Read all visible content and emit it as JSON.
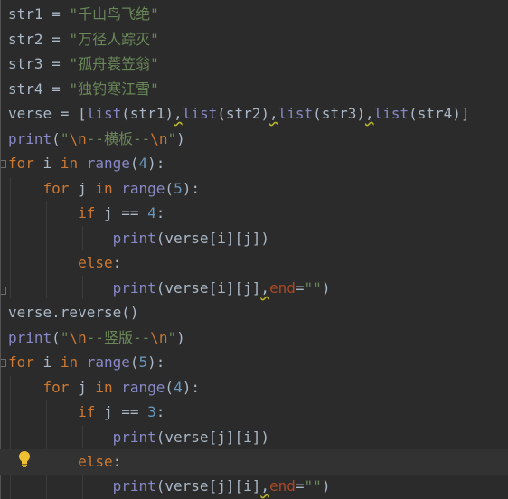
{
  "editor": {
    "lines": [
      "str1 = \"千山鸟飞绝\"",
      "str2 = \"万径人踪灭\"",
      "str3 = \"孤舟蓑笠翁\"",
      "str4 = \"独钓寒江雪\"",
      "verse = [list(str1),list(str2),list(str3),list(str4)]",
      "print(\"\\n--横板--\\n\")",
      "for i in range(4):",
      "    for j in range(5):",
      "        if j == 4:",
      "            print(verse[i][j])",
      "        else:",
      "            print(verse[i][j],end=\"\")",
      "verse.reverse()",
      "print(\"\\n--竖版--\\n\")",
      "for i in range(5):",
      "    for j in range(4):",
      "        if j == 3:",
      "            print(verse[j][i])",
      "        else:",
      "            print(verse[j][i],end=\"\")"
    ]
  },
  "tokens": {
    "l0": {
      "name": "str1",
      "op": " = ",
      "s1": "\"",
      "s2": "千山鸟飞绝",
      "s3": "\""
    },
    "l1": {
      "name": "str2",
      "op": " = ",
      "s1": "\"",
      "s2": "万径人踪灭",
      "s3": "\""
    },
    "l2": {
      "name": "str3",
      "op": " = ",
      "s1": "\"",
      "s2": "孤舟蓑笠翁",
      "s3": "\""
    },
    "l3": {
      "name": "str4",
      "op": " = ",
      "s1": "\"",
      "s2": "独钓寒江雪",
      "s3": "\""
    },
    "l4": {
      "a": "verse = [",
      "f1": "list",
      "p1": "(str1)",
      "c1": ",",
      "f2": "list",
      "p2": "(str2)",
      "c2": ",",
      "f3": "list",
      "p3": "(str3)",
      "c3": ",",
      "f4": "list",
      "p4": "(str4)]"
    },
    "l5": {
      "f": "print",
      "o": "(",
      "q1": "\"",
      "e1": "\\n",
      "t": "--横板--",
      "e2": "\\n",
      "q2": "\"",
      "c": ")"
    },
    "l6": {
      "k1": "for",
      "v": " i ",
      "k2": "in",
      "sp": " ",
      "f": "range",
      "o": "(",
      "n": "4",
      "c": "):"
    },
    "l7": {
      "ind": "    ",
      "k1": "for",
      "v": " j ",
      "k2": "in",
      "sp": " ",
      "f": "range",
      "o": "(",
      "n": "5",
      "c": "):"
    },
    "l8": {
      "ind": "        ",
      "k": "if",
      "e": " j == ",
      "n": "4",
      "c": ":"
    },
    "l9": {
      "ind": "            ",
      "f": "print",
      "r": "(verse[i][j])"
    },
    "l10": {
      "ind": "        ",
      "k": "else",
      "c": ":"
    },
    "l11": {
      "ind": "            ",
      "f": "print",
      "r": "(verse[i][j]",
      "cm": ",",
      "p": "end",
      "eq": "=",
      "s": "\"\"",
      "c": ")"
    },
    "l12": {
      "t": "verse.reverse()"
    },
    "l13": {
      "f": "print",
      "o": "(",
      "q1": "\"",
      "e1": "\\n",
      "t": "--竖版--",
      "e2": "\\n",
      "q2": "\"",
      "c": ")"
    },
    "l14": {
      "k1": "for",
      "v": " i ",
      "k2": "in",
      "sp": " ",
      "f": "range",
      "o": "(",
      "n": "5",
      "c": "):"
    },
    "l15": {
      "ind": "    ",
      "k1": "for",
      "v": " j ",
      "k2": "in",
      "sp": " ",
      "f": "range",
      "o": "(",
      "n": "4",
      "c": "):"
    },
    "l16": {
      "ind": "        ",
      "k": "if",
      "e": " j == ",
      "n": "3",
      "c": ":"
    },
    "l17": {
      "ind": "            ",
      "f": "print",
      "r": "(verse[j][i])"
    },
    "l18": {
      "ind": "        ",
      "k": "else",
      "c": ":"
    },
    "l19": {
      "ind": "            ",
      "f": "print",
      "r": "(verse[j][i]",
      "cm": ",",
      "p": "end",
      "eq": "=",
      "s": "\"\"",
      "c": ")"
    }
  },
  "icons": {
    "intention_bulb": "lightbulb-icon"
  },
  "colors": {
    "background": "#2b2b2b",
    "identifier": "#a9b7c6",
    "keyword": "#cc7832",
    "string": "#6a8759",
    "number": "#6897bb",
    "builtin": "#8888c6",
    "parameter": "#aa4926",
    "bulb": "#f0c033"
  }
}
